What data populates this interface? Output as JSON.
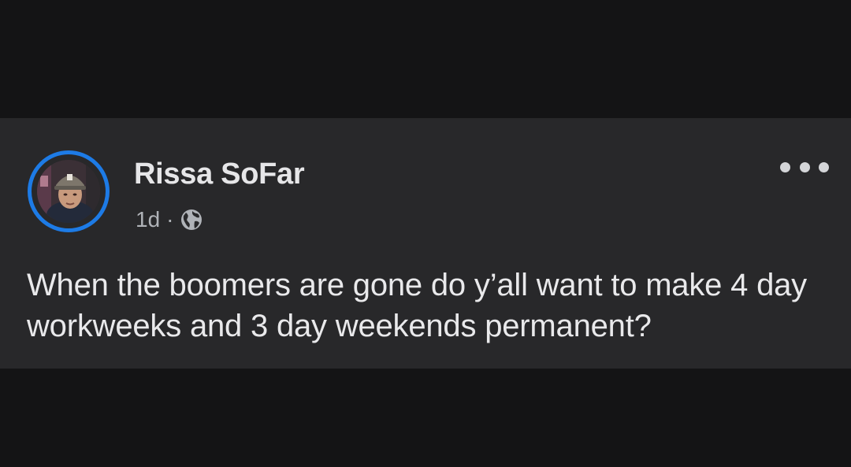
{
  "post": {
    "author": "Rissa SoFar",
    "time": "1d",
    "separator": "·",
    "audience_icon": "globe-icon",
    "more_icon": "more-options-icon",
    "text": "When the boomers are gone do y’all want to make 4 day workweeks and 3 day weekends permanent?"
  },
  "colors": {
    "page_background": "#141415",
    "card_background": "#28282a",
    "story_ring": "#1d7be6",
    "primary_text": "#e6e6e8",
    "secondary_text": "#b0b3b8"
  }
}
